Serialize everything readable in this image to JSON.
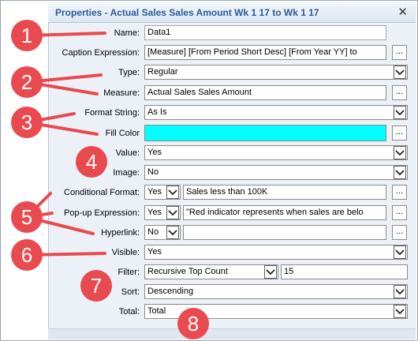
{
  "window": {
    "title": "Properties - Actual Sales Sales Amount Wk 1 17 to Wk 1 17",
    "close_glyph": "✕"
  },
  "fields": {
    "name": {
      "label": "Name:",
      "value": "Data1"
    },
    "caption_expression": {
      "label": "Caption Expression:",
      "value": "[Measure] [From Period Short Desc] [From Year YY] to"
    },
    "type": {
      "label": "Type:",
      "value": "Regular"
    },
    "measure": {
      "label": "Measure:",
      "value": "Actual Sales Sales Amount"
    },
    "format_string": {
      "label": "Format String:",
      "value": "As Is"
    },
    "fill_color": {
      "label": "Fill Color",
      "color": "#00ffff"
    },
    "value": {
      "label": "Value:",
      "value": "Yes"
    },
    "image": {
      "label": "Image:",
      "value": "No"
    },
    "conditional_format": {
      "label": "Conditional Format:",
      "toggle": "Yes",
      "value": "Sales less than 100K"
    },
    "popup_expression": {
      "label": "Pop-up Expression:",
      "toggle": "Yes",
      "value": "\"Red indicator represents when sales are belo"
    },
    "hyperlink": {
      "label": "Hyperlink:",
      "toggle": "No",
      "value": ""
    },
    "visible": {
      "label": "Visible:",
      "value": "Yes"
    },
    "filter": {
      "label": "Filter:",
      "value": "Recursive Top Count",
      "count": "15"
    },
    "sort": {
      "label": "Sort:",
      "value": "Descending"
    },
    "total": {
      "label": "Total:",
      "value": "Total"
    }
  },
  "ellipsis": "...",
  "callouts": [
    "1",
    "2",
    "3",
    "4",
    "5",
    "6",
    "7",
    "8"
  ],
  "colors": {
    "callout": "#e84a4f",
    "title": "#2a5a9a",
    "panel": "#ecf1f8"
  },
  "icons": {
    "dropdown": "chevron-down-icon",
    "close": "close-icon"
  }
}
